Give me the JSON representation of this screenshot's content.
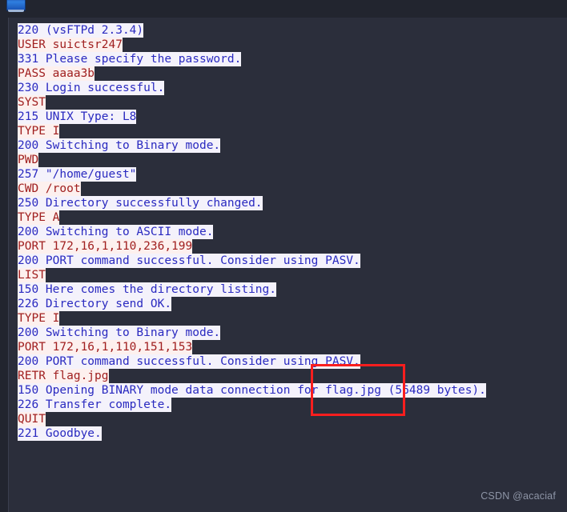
{
  "window": {
    "icon": "ftp-client-window-icon",
    "title": ""
  },
  "transcript": {
    "lines": [
      {
        "kind": "response",
        "text": "220 (vsFTPd 2.3.4)"
      },
      {
        "kind": "request",
        "text": "USER suictsr247"
      },
      {
        "kind": "response",
        "text": "331 Please specify the password."
      },
      {
        "kind": "request",
        "text": "PASS aaaa3b"
      },
      {
        "kind": "response",
        "text": "230 Login successful."
      },
      {
        "kind": "request",
        "text": "SYST"
      },
      {
        "kind": "response",
        "text": "215 UNIX Type: L8"
      },
      {
        "kind": "request",
        "text": "TYPE I"
      },
      {
        "kind": "response",
        "text": "200 Switching to Binary mode."
      },
      {
        "kind": "request",
        "text": "PWD"
      },
      {
        "kind": "response",
        "text": "257 \"/home/guest\""
      },
      {
        "kind": "request",
        "text": "CWD /root"
      },
      {
        "kind": "response",
        "text": "250 Directory successfully changed."
      },
      {
        "kind": "request",
        "text": "TYPE A"
      },
      {
        "kind": "response",
        "text": "200 Switching to ASCII mode."
      },
      {
        "kind": "request",
        "text": "PORT 172,16,1,110,236,199"
      },
      {
        "kind": "response",
        "text": "200 PORT command successful. Consider using PASV."
      },
      {
        "kind": "request",
        "text": "LIST"
      },
      {
        "kind": "response",
        "text": "150 Here comes the directory listing."
      },
      {
        "kind": "response",
        "text": "226 Directory send OK."
      },
      {
        "kind": "request",
        "text": "TYPE I"
      },
      {
        "kind": "response",
        "text": "200 Switching to Binary mode."
      },
      {
        "kind": "request",
        "text": "PORT 172,16,1,110,151,153"
      },
      {
        "kind": "response",
        "text": "200 PORT command successful. Consider using PASV."
      },
      {
        "kind": "request",
        "text": "RETR flag.jpg"
      },
      {
        "kind": "response",
        "text": "150 Opening BINARY mode data connection for flag.jpg (56489 bytes)."
      },
      {
        "kind": "response",
        "text": "226 Transfer complete."
      },
      {
        "kind": "request",
        "text": "QUIT"
      },
      {
        "kind": "response",
        "text": "221 Goodbye."
      }
    ]
  },
  "annotation": {
    "shape": "rectangle",
    "color": "#fa1e1e",
    "label": ""
  },
  "watermark": {
    "text": "CSDN @acaciaf"
  },
  "colors": {
    "background": "#2b2e3b",
    "topbar": "#22252f",
    "response_text": "#2a2ac0",
    "response_highlight": "#f4f2fb",
    "request_text": "#a01f1f",
    "request_highlight": "#fdf0ee",
    "annotation": "#fa1e1e",
    "watermark": "#8e95a6"
  }
}
